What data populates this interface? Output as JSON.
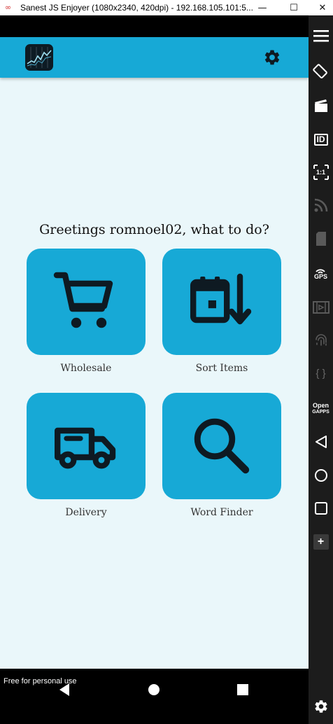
{
  "window": {
    "title": "Sanest JS Enjoyer (1080x2340, 420dpi) - 192.168.105.101:5...",
    "minimize_glyph": "—",
    "maximize_glyph": "☐",
    "close_glyph": "✕"
  },
  "app": {
    "greeting": "Greetings romnoel02, what to do?",
    "accent_color": "#17a9d6",
    "background_color": "#eaf7fa",
    "tiles": [
      {
        "label": "Wholesale",
        "icon": "cart-icon"
      },
      {
        "label": "Sort Items",
        "icon": "calendar-sort-icon"
      },
      {
        "label": "Delivery",
        "icon": "truck-icon"
      },
      {
        "label": "Word Finder",
        "icon": "search-icon"
      }
    ]
  },
  "emulator_toolbar": {
    "id_label": "ID",
    "ratio_label": "1:1",
    "gps_label": "GPS",
    "brackets_label": "{ }",
    "opengapps_line1": "Open",
    "opengapps_line2": "GAPPS",
    "add_label": "+"
  },
  "watermark": "Free for personal use"
}
